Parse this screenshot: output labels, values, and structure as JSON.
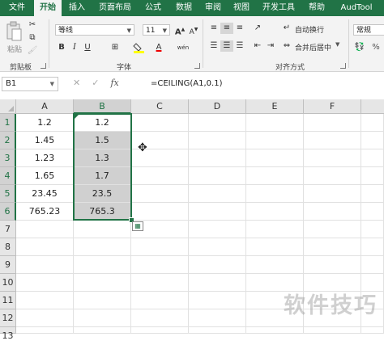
{
  "ribbon_tabs": [
    "文件",
    "开始",
    "插入",
    "页面布局",
    "公式",
    "数据",
    "审阅",
    "视图",
    "开发工具",
    "帮助",
    "AudTool"
  ],
  "active_tab": "开始",
  "ribbon": {
    "clipboard": {
      "paste_label": "粘贴",
      "group_label": "剪贴板"
    },
    "font": {
      "font_name": "等线",
      "font_size": "11",
      "group_label": "字体"
    },
    "alignment": {
      "wrap_label": "自动换行",
      "merge_label": "合并后居中",
      "group_label": "对齐方式"
    },
    "number": {
      "format": "常规"
    }
  },
  "formula_bar": {
    "name_box": "B1",
    "fx": "fx",
    "formula": "=CEILING(A1,0.1)"
  },
  "columns": [
    "A",
    "B",
    "C",
    "D",
    "E",
    "F"
  ],
  "rows": [
    "1",
    "2",
    "3",
    "4",
    "5",
    "6",
    "7",
    "8",
    "9",
    "10",
    "11",
    "12",
    "13"
  ],
  "cells": {
    "A": [
      "1.2",
      "1.45",
      "1.23",
      "1.65",
      "23.45",
      "765.23"
    ],
    "B": [
      "1.2",
      "1.5",
      "1.3",
      "1.7",
      "23.5",
      "765.3"
    ]
  },
  "selected_column": "B",
  "selected_rows": [
    "1",
    "2",
    "3",
    "4",
    "5",
    "6"
  ],
  "watermark": "软件技巧",
  "colors": {
    "accent": "#217346",
    "selection_fill": "#d0d0d0"
  }
}
